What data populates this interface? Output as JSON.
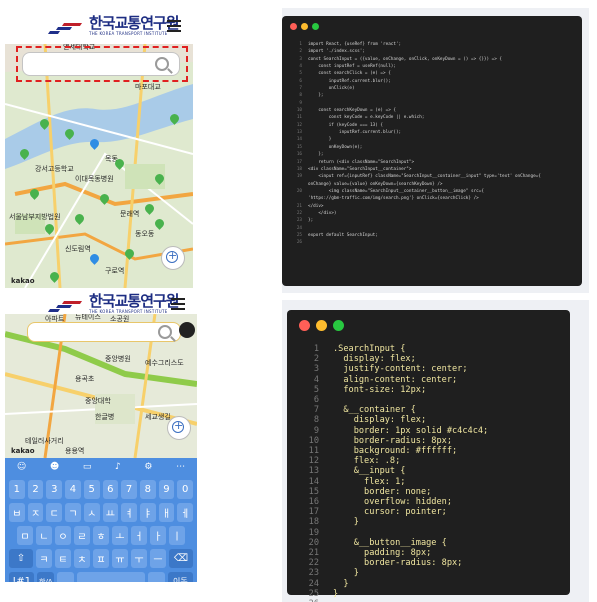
{
  "phone1": {
    "logo_ko": "한국교통연구원",
    "logo_en": "THE KOREA TRANSPORT INSTITUTE",
    "map_labels": [
      "연세대학교",
      "마포대교",
      "이대목동병원",
      "강서고등학교",
      "목동",
      "경인로",
      "서울남부지방법원",
      "한국폴리텍",
      "유통단지",
      "문래역",
      "신도림역",
      "구로역",
      "구로동",
      "한국인구종",
      "수협은행",
      "기흥동",
      "이태원",
      "동오동",
      "진명여자고",
      "용산구",
      "동작구"
    ],
    "attribution": "kakao"
  },
  "phone2": {
    "logo_ko": "한국교통연구원",
    "logo_en": "THE KOREA TRANSPORT INSTITUTE",
    "map_labels": [
      "아파트",
      "뉴테이스",
      "소공원",
      "한강사",
      "부산지방",
      "중앙병원",
      "예수그리스도",
      "후기성도교회",
      "강수원",
      "용곡초",
      "위원회",
      "한국교육",
      "신촌중학교",
      "용서한",
      "환진인",
      "테크노",
      "중앙대학",
      "남부",
      "중앙대",
      "대학교",
      "김대원",
      "마포원",
      "인가포",
      "한글병",
      "세교생길",
      "산정동원",
      "소월감",
      "동진원원",
      "동진빌딩",
      "한국공항원",
      "한국세관",
      "원정동",
      "서부",
      "원진문동",
      "테일러사거리",
      "큰빈기",
      "용용역",
      "약물방",
      "도르티"
    ],
    "attribution": "kakao",
    "keyboard": {
      "numbers": [
        "1",
        "2",
        "3",
        "4",
        "5",
        "6",
        "7",
        "8",
        "9",
        "0"
      ],
      "row1": [
        "ㅂ",
        "ㅈ",
        "ㄷ",
        "ㄱ",
        "ㅅ",
        "ㅛ",
        "ㅕ",
        "ㅑ",
        "ㅐ",
        "ㅔ"
      ],
      "row2": [
        "ㅁ",
        "ㄴ",
        "ㅇ",
        "ㄹ",
        "ㅎ",
        "ㅗ",
        "ㅓ",
        "ㅏ",
        "ㅣ"
      ],
      "row3": [
        "ㅋ",
        "ㅌ",
        "ㅊ",
        "ㅍ",
        "ㅠ",
        "ㅜ",
        "ㅡ"
      ],
      "shift": "⇧",
      "backspace": "⌫",
      "sym": "!#1",
      "lang": "한/A",
      "comma": ",",
      "period": ".",
      "enter": "이동"
    }
  },
  "code_js": {
    "lines": [
      "import React, {useRef} from 'react';",
      "import './index.scss';",
      "const SearchInput = ({value, onChange, onClick, onKeyDown = () => {}}) => {",
      "    const inputRef = useRef(null);",
      "    const searchClick = (e) => {",
      "        inputRef.current.blur();",
      "        onClick(e)",
      "    };",
      "",
      "    const searchKeyDown = (e) => {",
      "        const keyCode = e.keyCode || e.which;",
      "        if (keyCode === 13) {",
      "            inputRef.current.blur();",
      "        }",
      "        onKeyDown(e);",
      "    };",
      "    return (<div className=\"SearchInput\">",
      "<div className=\"SearchInput__container\">",
      "    <input ref={inputRef} className=\"SearchInput__container__input\" type='text' onChange={",
      "onChange} value={value} onKeyDown={searchKeyDown} />",
      "        <img className=\"SearchInput__container__button__image\" src={",
      "'https://gbm-traffic.com/img/search.png'} onClick={searchClick} />",
      "</div>",
      "    </div>)",
      "};",
      "",
      "export default SearchInput;",
      ""
    ],
    "numbers": [
      "1",
      "2",
      "3",
      "4",
      "5",
      "6",
      "7",
      "8",
      "9",
      "10",
      "11",
      "12",
      "13",
      "14",
      "15",
      "16",
      "17",
      "18",
      "19",
      "",
      "20",
      "",
      "21",
      "22",
      "23",
      "24",
      "25",
      "26"
    ]
  },
  "code_css": {
    "lines": [
      ".SearchInput {",
      "  display: flex;",
      "  justify-content: center;",
      "  align-content: center;",
      "  font-size: 12px;",
      "",
      "  &__container {",
      "    display: flex;",
      "    border: 1px solid #c4c4c4;",
      "    border-radius: 8px;",
      "    background: #ffffff;",
      "    flex: .8;",
      "    &__input {",
      "      flex: 1;",
      "      border: none;",
      "      overflow: hidden;",
      "      cursor: pointer;",
      "    }",
      "",
      "    &__button__image {",
      "      padding: 8px;",
      "      border-radius: 8px;",
      "    }",
      "  }",
      "}",
      ""
    ],
    "numbers": [
      "1",
      "2",
      "3",
      "4",
      "5",
      "6",
      "7",
      "8",
      "9",
      "10",
      "11",
      "12",
      "13",
      "14",
      "15",
      "16",
      "17",
      "18",
      "19",
      "20",
      "21",
      "22",
      "23",
      "24",
      "25",
      "26"
    ]
  },
  "colors": {
    "dot_red": "#ff5f57",
    "dot_yellow": "#febc2e",
    "dot_green": "#28c840",
    "highlight": "#e02020",
    "keyboard": "#4e8ee0"
  }
}
